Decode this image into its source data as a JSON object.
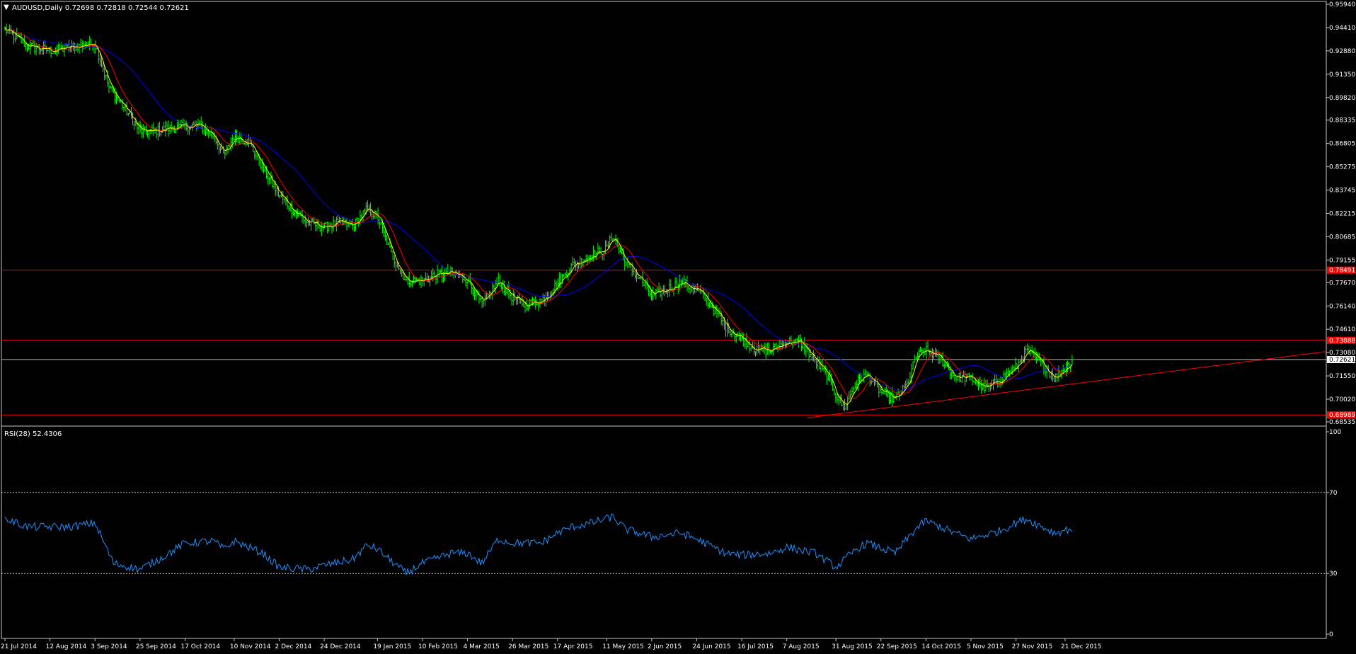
{
  "colors": {
    "background": "#000000",
    "frame": "#c8c8c8",
    "bull_candle": "#00ff00",
    "fast_ma": "#ff0000",
    "slow_ma": "#0000ff",
    "short_ma": "#ffff00",
    "horizontal_line": "#ff0000",
    "trend_line": "#ff0000",
    "bid_line": "#c0c0c0",
    "rsi_line": "#1e90ff",
    "rsi_level": "#c0c0c0",
    "tag_red": "#ff0000",
    "tag_bid": "#ffffff"
  },
  "chart_data": [
    {
      "type": "candlestick",
      "title": "AUDUSD,Daily",
      "ohlc_header": "0.72698 0.72818 0.72544 0.72621",
      "price_ticks": [
        "0.95940",
        "0.94410",
        "0.92880",
        "0.91350",
        "0.89820",
        "0.88335",
        "0.86805",
        "0.85275",
        "0.83745",
        "0.82215",
        "0.80685",
        "0.79155",
        "0.77670",
        "0.76140",
        "0.74610",
        "0.73080",
        "0.71550",
        "0.70020",
        "0.68535"
      ],
      "ylim": [
        0.68535,
        0.9594
      ],
      "date_ticks": [
        "21 Jul 2014",
        "12 Aug 2014",
        "3 Sep 2014",
        "25 Sep 2014",
        "17 Oct 2014",
        "10 Nov 2014",
        "2 Dec 2014",
        "24 Dec 2014",
        "19 Jan 2015",
        "10 Feb 2015",
        "4 Mar 2015",
        "26 Mar 2015",
        "17 Apr 2015",
        "11 May 2015",
        "2 Jun 2015",
        "24 Jun 2015",
        "16 Jul 2015",
        "7 Aug 2015",
        "31 Aug 2015",
        "22 Sep 2015",
        "14 Oct 2015",
        "5 Nov 2015",
        "27 Nov 2015",
        "21 Dec 2015"
      ],
      "horizontal_levels": [
        {
          "label": "0.78491",
          "value": 0.78491
        },
        {
          "label": "0.73888",
          "value": 0.73888
        },
        {
          "label": "0.68989",
          "value": 0.68989
        }
      ],
      "bid": {
        "label": "0.72621",
        "value": 0.72621
      },
      "trend_line": {
        "from": {
          "date": "17 Aug 2015",
          "price": 0.688
        },
        "to": {
          "date": "end",
          "price": 0.7315
        }
      },
      "close_path": [
        [
          "21 Jul 2014",
          0.943
        ],
        [
          "1 Aug 2014",
          0.932
        ],
        [
          "12 Aug 2014",
          0.929
        ],
        [
          "22 Aug 2014",
          0.931
        ],
        [
          "3 Sep 2014",
          0.934
        ],
        [
          "10 Sep 2014",
          0.904
        ],
        [
          "17 Sep 2014",
          0.892
        ],
        [
          "25 Sep 2014",
          0.876
        ],
        [
          "2 Oct 2014",
          0.876
        ],
        [
          "9 Oct 2014",
          0.878
        ],
        [
          "17 Oct 2014",
          0.879
        ],
        [
          "24 Oct 2014",
          0.88
        ],
        [
          "31 Oct 2014",
          0.873
        ],
        [
          "5 Nov 2014",
          0.86
        ],
        [
          "10 Nov 2014",
          0.873
        ],
        [
          "17 Nov 2014",
          0.869
        ],
        [
          "24 Nov 2014",
          0.852
        ],
        [
          "2 Dec 2014",
          0.834
        ],
        [
          "9 Dec 2014",
          0.824
        ],
        [
          "16 Dec 2014",
          0.816
        ],
        [
          "24 Dec 2014",
          0.813
        ],
        [
          "31 Dec 2014",
          0.816
        ],
        [
          "7 Jan 2015",
          0.814
        ],
        [
          "14 Jan 2015",
          0.825
        ],
        [
          "19 Jan 2015",
          0.82
        ],
        [
          "26 Jan 2015",
          0.795
        ],
        [
          "2 Feb 2015",
          0.778
        ],
        [
          "10 Feb 2015",
          0.778
        ],
        [
          "17 Feb 2015",
          0.782
        ],
        [
          "24 Feb 2015",
          0.783
        ],
        [
          "4 Mar 2015",
          0.779
        ],
        [
          "11 Mar 2015",
          0.762
        ],
        [
          "19 Mar 2015",
          0.778
        ],
        [
          "26 Mar 2015",
          0.767
        ],
        [
          "1 Apr 2015",
          0.762
        ],
        [
          "9 Apr 2015",
          0.765
        ],
        [
          "17 Apr 2015",
          0.776
        ],
        [
          "24 Apr 2015",
          0.788
        ],
        [
          "4 May 2015",
          0.795
        ],
        [
          "11 May 2015",
          0.799
        ],
        [
          "14 May 2015",
          0.808
        ],
        [
          "20 May 2015",
          0.79
        ],
        [
          "27 May 2015",
          0.78
        ],
        [
          "2 Jun 2015",
          0.768
        ],
        [
          "9 Jun 2015",
          0.772
        ],
        [
          "16 Jun 2015",
          0.777
        ],
        [
          "24 Jun 2015",
          0.772
        ],
        [
          "1 Jul 2015",
          0.762
        ],
        [
          "8 Jul 2015",
          0.748
        ],
        [
          "16 Jul 2015",
          0.74
        ],
        [
          "23 Jul 2015",
          0.733
        ],
        [
          "30 Jul 2015",
          0.732
        ],
        [
          "7 Aug 2015",
          0.738
        ],
        [
          "14 Aug 2015",
          0.737
        ],
        [
          "21 Aug 2015",
          0.725
        ],
        [
          "27 Aug 2015",
          0.715
        ],
        [
          "31 Aug 2015",
          0.703
        ],
        [
          "4 Sep 2015",
          0.695
        ],
        [
          "10 Sep 2015",
          0.711
        ],
        [
          "15 Sep 2015",
          0.717
        ],
        [
          "22 Sep 2015",
          0.705
        ],
        [
          "29 Sep 2015",
          0.7
        ],
        [
          "5 Oct 2015",
          0.71
        ],
        [
          "9 Oct 2015",
          0.728
        ],
        [
          "14 Oct 2015",
          0.732
        ],
        [
          "21 Oct 2015",
          0.727
        ],
        [
          "28 Oct 2015",
          0.715
        ],
        [
          "5 Nov 2015",
          0.714
        ],
        [
          "12 Nov 2015",
          0.707
        ],
        [
          "19 Nov 2015",
          0.713
        ],
        [
          "27 Nov 2015",
          0.721
        ],
        [
          "2 Dec 2015",
          0.732
        ],
        [
          "9 Dec 2015",
          0.724
        ],
        [
          "16 Dec 2015",
          0.714
        ],
        [
          "21 Dec 2015",
          0.721
        ],
        [
          "25 Dec 2015",
          0.7262
        ]
      ]
    },
    {
      "type": "line",
      "title": "RSI(28) 52.4306",
      "yticks": [
        "100",
        "70",
        "30",
        "0"
      ],
      "levels": [
        70,
        30
      ],
      "ylim": [
        0,
        100
      ],
      "series": [
        {
          "values": [
            [
              "21 Jul 2014",
              57
            ],
            [
              "1 Aug 2014",
              53
            ],
            [
              "12 Aug 2014",
              53
            ],
            [
              "22 Aug 2014",
              53
            ],
            [
              "3 Sep 2014",
              55
            ],
            [
              "12 Sep 2014",
              35
            ],
            [
              "25 Sep 2014",
              32
            ],
            [
              "6 Oct 2014",
              38
            ],
            [
              "17 Oct 2014",
              45
            ],
            [
              "31 Oct 2014",
              46
            ],
            [
              "5 Nov 2014",
              42
            ],
            [
              "10 Nov 2014",
              46
            ],
            [
              "24 Nov 2014",
              40
            ],
            [
              "2 Dec 2014",
              33
            ],
            [
              "16 Dec 2014",
              32
            ],
            [
              "24 Dec 2014",
              34
            ],
            [
              "7 Jan 2015",
              37
            ],
            [
              "14 Jan 2015",
              44
            ],
            [
              "19 Jan 2015",
              42
            ],
            [
              "2 Feb 2015",
              30
            ],
            [
              "10 Feb 2015",
              35
            ],
            [
              "24 Feb 2015",
              40
            ],
            [
              "4 Mar 2015",
              40
            ],
            [
              "11 Mar 2015",
              35
            ],
            [
              "19 Mar 2015",
              47
            ],
            [
              "26 Mar 2015",
              45
            ],
            [
              "9 Apr 2015",
              45
            ],
            [
              "17 Apr 2015",
              50
            ],
            [
              "24 Apr 2015",
              53
            ],
            [
              "4 May 2015",
              55
            ],
            [
              "14 May 2015",
              58
            ],
            [
              "20 May 2015",
              52
            ],
            [
              "2 Jun 2015",
              48
            ],
            [
              "16 Jun 2015",
              50
            ],
            [
              "24 Jun 2015",
              47
            ],
            [
              "8 Jul 2015",
              40
            ],
            [
              "16 Jul 2015",
              39
            ],
            [
              "30 Jul 2015",
              40
            ],
            [
              "7 Aug 2015",
              43
            ],
            [
              "21 Aug 2015",
              40
            ],
            [
              "31 Aug 2015",
              33
            ],
            [
              "10 Sep 2015",
              42
            ],
            [
              "15 Sep 2015",
              45
            ],
            [
              "29 Sep 2015",
              40
            ],
            [
              "9 Oct 2015",
              52
            ],
            [
              "14 Oct 2015",
              56
            ],
            [
              "28 Oct 2015",
              50
            ],
            [
              "5 Nov 2015",
              47
            ],
            [
              "19 Nov 2015",
              51
            ],
            [
              "27 Nov 2015",
              55
            ],
            [
              "2 Dec 2015",
              57
            ],
            [
              "16 Dec 2015",
              50
            ],
            [
              "25 Dec 2015",
              52.43
            ]
          ]
        }
      ]
    }
  ]
}
